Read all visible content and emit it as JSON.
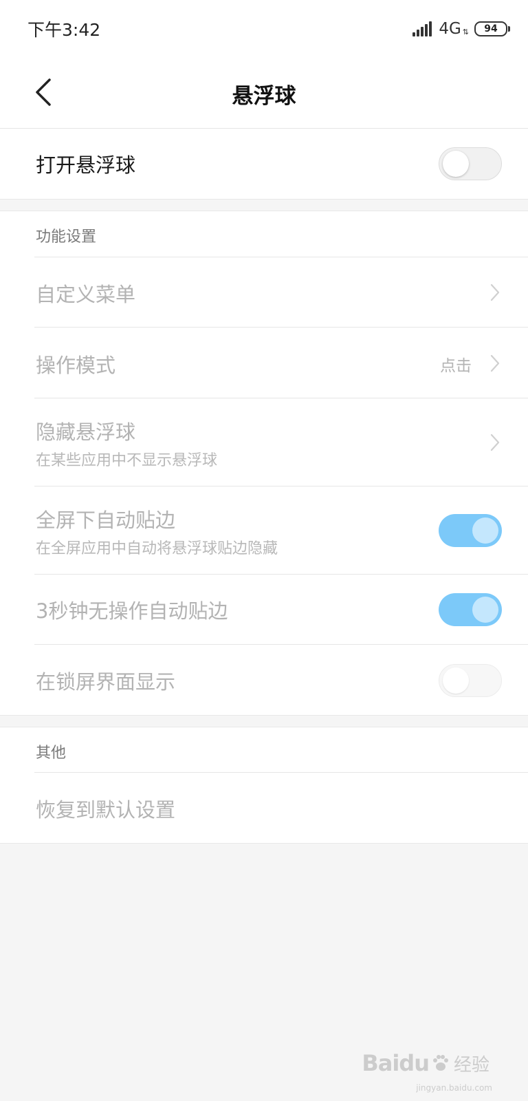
{
  "status_bar": {
    "time": "下午3:42",
    "network": "4G",
    "battery": "94"
  },
  "header": {
    "title": "悬浮球"
  },
  "main_toggle": {
    "label": "打开悬浮球",
    "on": false
  },
  "function_section": {
    "header": "功能设置",
    "custom_menu": {
      "label": "自定义菜单"
    },
    "operation_mode": {
      "label": "操作模式",
      "value": "点击"
    },
    "hide_ball": {
      "label": "隐藏悬浮球",
      "sublabel": "在某些应用中不显示悬浮球"
    },
    "fullscreen_edge": {
      "label": "全屏下自动贴边",
      "sublabel": "在全屏应用中自动将悬浮球贴边隐藏",
      "on": true
    },
    "idle_edge": {
      "label": "3秒钟无操作自动贴边",
      "on": true
    },
    "lock_screen": {
      "label": "在锁屏界面显示",
      "on": false
    }
  },
  "other_section": {
    "header": "其他",
    "restore_default": {
      "label": "恢复到默认设置"
    }
  },
  "watermark": {
    "logo": "Baidu",
    "product": "经验",
    "url": "jingyan.baidu.com"
  },
  "colors": {
    "toggle_on": "#7cc9f9",
    "disabled_text": "#b3b3b3",
    "background": "#f5f5f5"
  }
}
